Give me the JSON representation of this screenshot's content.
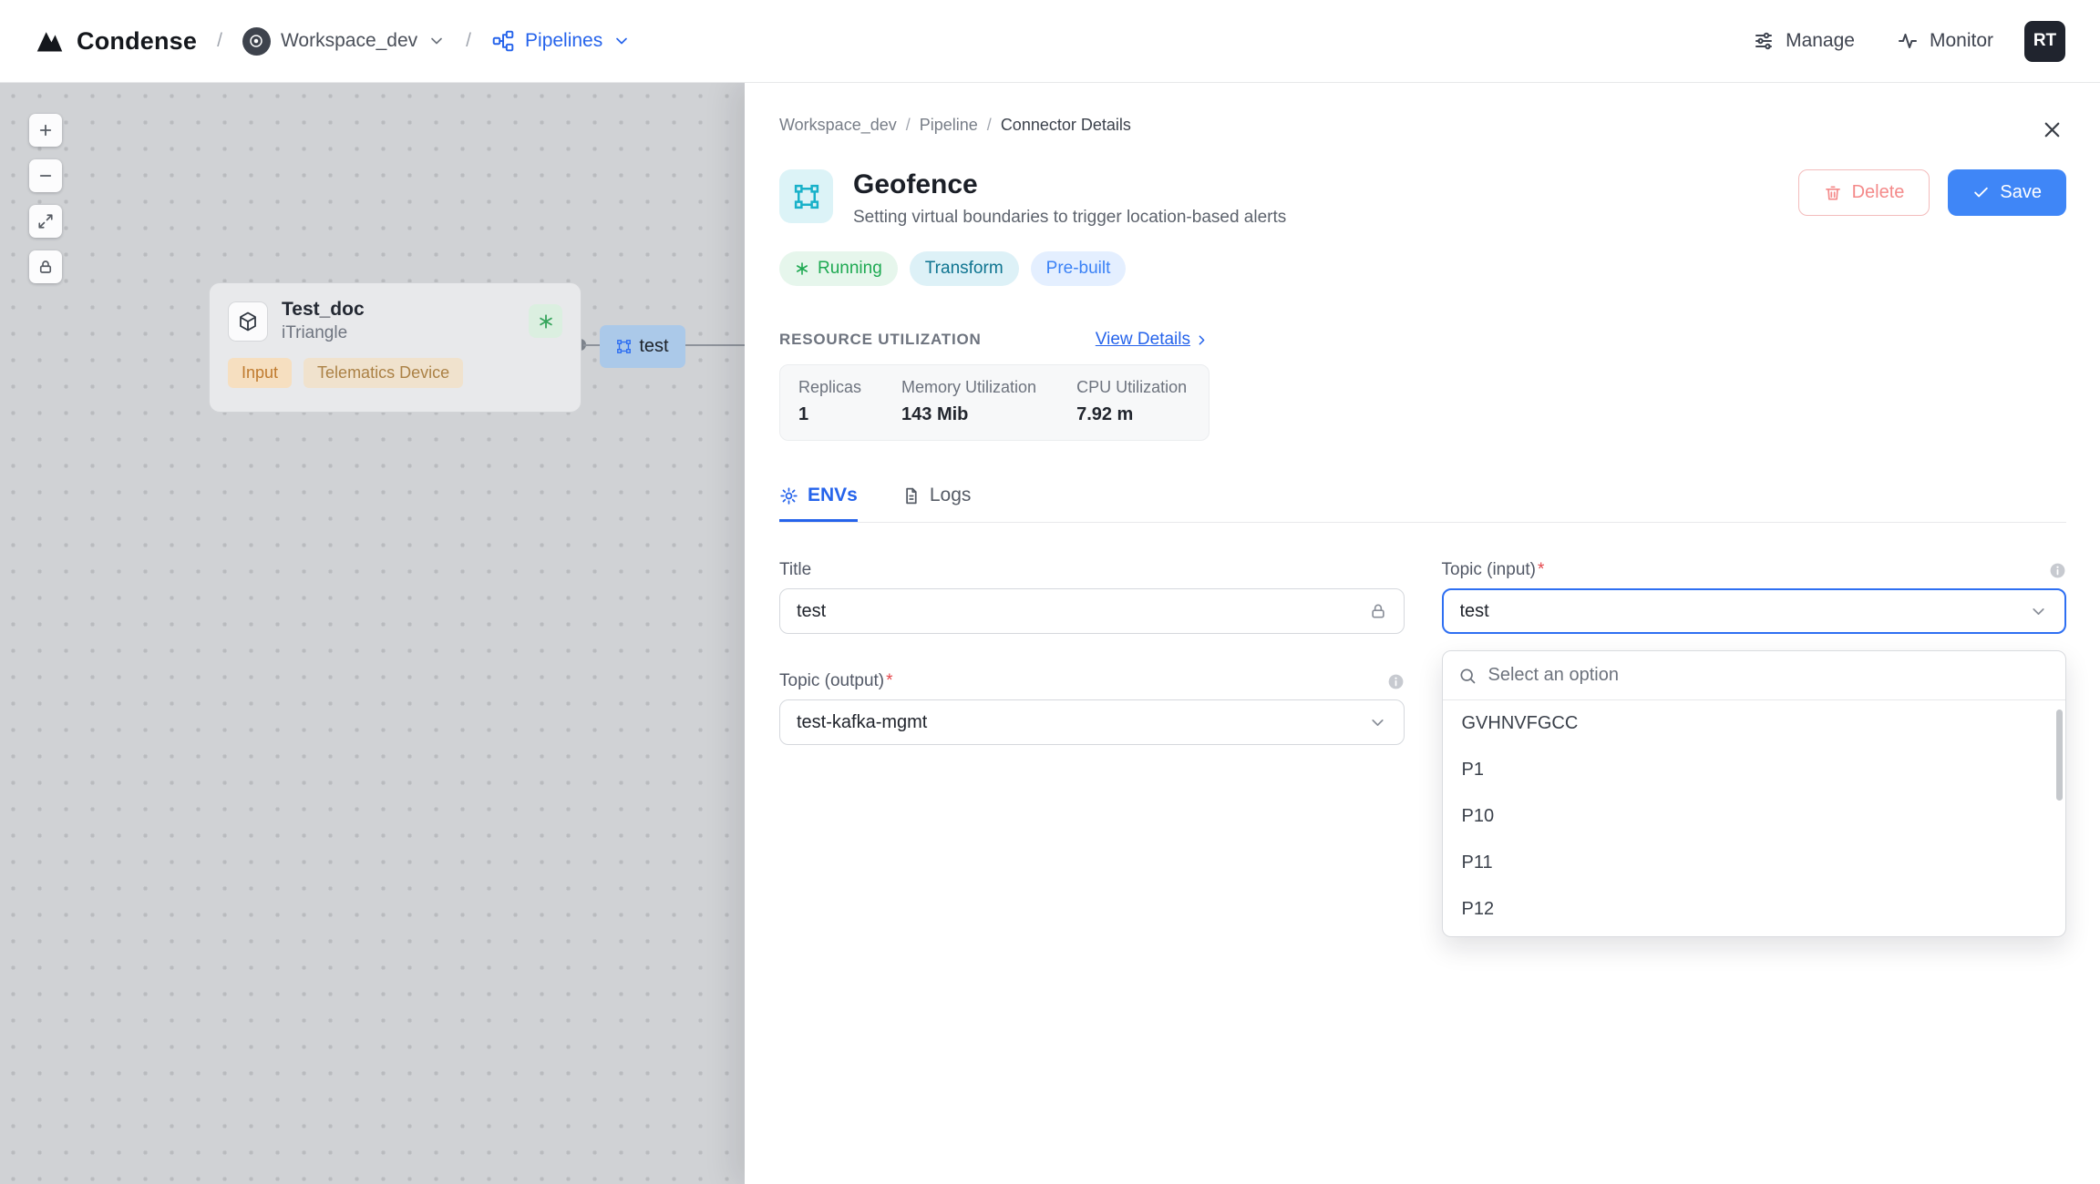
{
  "colors": {
    "accent": "#3f86f7",
    "link-blue": "#2563eb",
    "success": "#1ea952",
    "success-bg": "#e6f6ec",
    "teal-text": "#0e7490",
    "prebuilt-text": "#3b82f6",
    "prebuilt-bg": "#e4efff",
    "danger": "#f48a8a",
    "danger-border": "#f3bcbc",
    "canvas-bg": "#d0d2d5",
    "canvas-dot": "#b9bbbe",
    "tag-text": "#bf7a2e",
    "tag-bg": "#f6dfc0",
    "chip-bg": "#abc9e9"
  },
  "navbar": {
    "brand": "Condense",
    "separator": "/",
    "workspace_label": "Workspace_dev",
    "pipelines_label": "Pipelines",
    "manage_label": "Manage",
    "monitor_label": "Monitor",
    "avatar_initials": "RT"
  },
  "canvas": {
    "node": {
      "title": "Test_doc",
      "subtitle": "iTriangle",
      "tag_input": "Input",
      "tag_device": "Telematics Device"
    },
    "chip_label": "test"
  },
  "panel": {
    "breadcrumb": {
      "items": [
        "Workspace_dev",
        "Pipeline",
        "Connector Details"
      ],
      "separator": "/"
    },
    "header": {
      "title": "Geofence",
      "subtitle": "Setting virtual boundaries to trigger location-based alerts",
      "delete_label": "Delete",
      "save_label": "Save"
    },
    "badges": {
      "status": "Running",
      "type": "Transform",
      "origin": "Pre-built"
    },
    "resource": {
      "heading": "RESOURCE UTILIZATION",
      "view_details_label": "View Details",
      "metrics": [
        {
          "label": "Replicas",
          "value": "1"
        },
        {
          "label": "Memory Utilization",
          "value": "143 Mib"
        },
        {
          "label": "CPU Utilization",
          "value": "7.92 m"
        }
      ]
    },
    "tabs": {
      "envs": "ENVs",
      "logs": "Logs"
    },
    "form": {
      "title_label": "Title",
      "title_value": "test",
      "topic_input_label": "Topic (input)",
      "topic_input_required": "*",
      "topic_input_value": "test",
      "topic_output_label": "Topic (output)",
      "topic_output_required": "*",
      "topic_output_value": "test-kafka-mgmt",
      "dropdown": {
        "search_placeholder": "Select an option",
        "options": [
          "GVHNVFGCC",
          "P1",
          "P10",
          "P11",
          "P12"
        ]
      }
    }
  }
}
